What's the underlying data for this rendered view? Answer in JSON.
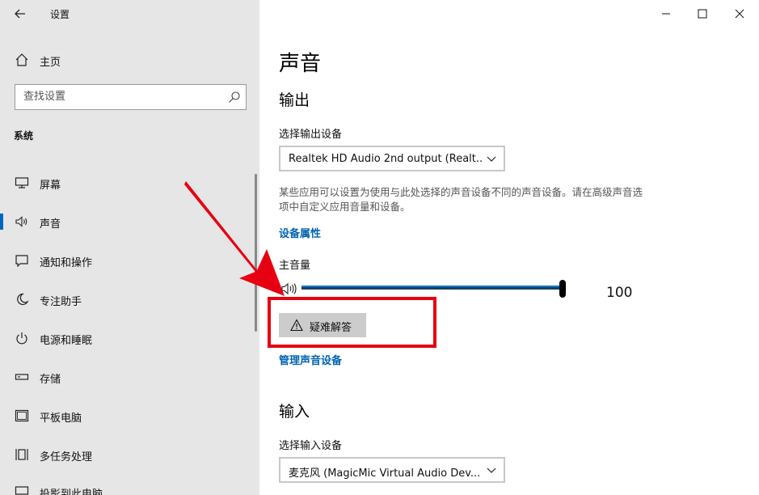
{
  "window": {
    "title": "设置",
    "controls": [
      "minimize",
      "maximize",
      "close"
    ]
  },
  "sidebar": {
    "home_label": "主页",
    "search_placeholder": "查找设置",
    "section": "系统",
    "items": [
      {
        "label": "屏幕",
        "icon": "monitor-icon"
      },
      {
        "label": "声音",
        "icon": "speaker-icon",
        "active": true
      },
      {
        "label": "通知和操作",
        "icon": "notification-icon"
      },
      {
        "label": "专注助手",
        "icon": "moon-icon"
      },
      {
        "label": "电源和睡眠",
        "icon": "power-icon"
      },
      {
        "label": "存储",
        "icon": "storage-icon"
      },
      {
        "label": "平板电脑",
        "icon": "tablet-icon"
      },
      {
        "label": "多任务处理",
        "icon": "multitask-icon"
      },
      {
        "label": "投影到此电脑",
        "icon": "projection-icon"
      }
    ]
  },
  "main": {
    "title": "声音",
    "output": {
      "heading": "输出",
      "device_label": "选择输出设备",
      "device_value": "Realtek HD Audio 2nd output (Realt...",
      "description": "某些应用可以设置为使用与此处选择的声音设备不同的声音设备。请在高级声音选项中自定义应用音量和设备。",
      "properties_link": "设备属性",
      "volume_label": "主音量",
      "volume_value": "100",
      "troubleshoot_label": "疑难解答",
      "manage_link": "管理声音设备"
    },
    "input": {
      "heading": "输入",
      "device_label": "选择输入设备",
      "device_value": "麦克风 (MagicMic Virtual Audio Dev..."
    }
  },
  "colors": {
    "accent": "#0078d7",
    "link": "#0063b1",
    "annotation": "#e60012",
    "sidebar_bg": "#e6e6e6"
  }
}
